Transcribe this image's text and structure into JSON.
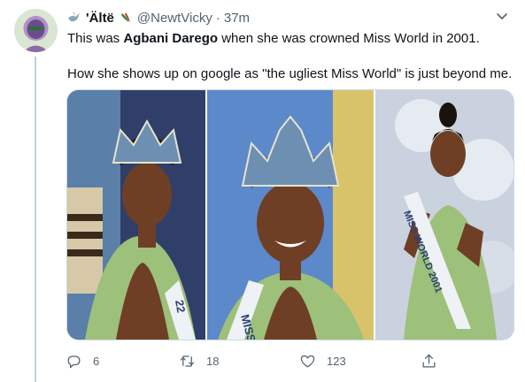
{
  "tweet": {
    "author_name": "'Ältë",
    "handle": "@NewtVicky",
    "separator": "·",
    "time": "37m",
    "text_line1_pre": "This was ",
    "text_line1_bold": "Agbani Darego",
    "text_line1_post": " when she was crowned Miss World in 2001.",
    "text_line2": "How she shows up on google as \"the ugliest Miss World\" is just beyond me.",
    "media": {
      "sash_text_left": "22",
      "sash_text_mid": "MISS",
      "sash_text_right": "MISS WORLD 2001"
    },
    "actions": {
      "reply_count": "6",
      "retweet_count": "18",
      "like_count": "123"
    }
  },
  "colors": {
    "text": "#0f1419",
    "secondary": "#536471",
    "thread_line": "#c4cfd6",
    "dress_green": "#9dc07a"
  },
  "icons": [
    "dove-icon",
    "chili-icon",
    "chevron-down-icon",
    "reply-icon",
    "retweet-icon",
    "like-icon",
    "share-icon"
  ]
}
